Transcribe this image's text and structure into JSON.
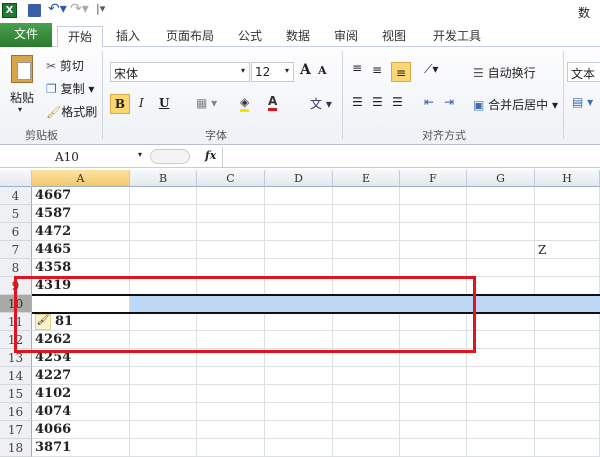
{
  "title_bar": {
    "title": "数据"
  },
  "tabs": [
    {
      "label": "文件"
    },
    {
      "label": "开始"
    },
    {
      "label": "插入"
    },
    {
      "label": "页面布局"
    },
    {
      "label": "公式"
    },
    {
      "label": "数据"
    },
    {
      "label": "审阅"
    },
    {
      "label": "视图"
    },
    {
      "label": "开发工具"
    }
  ],
  "ribbon": {
    "clipboard": {
      "paste": "粘贴",
      "cut": "剪切",
      "copy": "复制",
      "format_painter": "格式刷",
      "label": "剪贴板"
    },
    "font": {
      "font_name": "宋体",
      "font_size": "12",
      "bold": "B",
      "italic": "I",
      "underline": "U",
      "label": "字体"
    },
    "alignment": {
      "wrap": "自动换行",
      "merge": "合并后居中",
      "label": "对齐方式"
    },
    "number": {
      "format": "文本"
    }
  },
  "formula_bar": {
    "name_box": "A10",
    "fx": "fx",
    "value": ""
  },
  "columns": [
    "A",
    "B",
    "C",
    "D",
    "E",
    "F",
    "G",
    "H"
  ],
  "rows": [
    {
      "n": "4",
      "a": "4667"
    },
    {
      "n": "5",
      "a": "4587"
    },
    {
      "n": "6",
      "a": "4472"
    },
    {
      "n": "7",
      "a": "4465",
      "h": "Z"
    },
    {
      "n": "8",
      "a": "4358"
    },
    {
      "n": "9",
      "a": "4319"
    },
    {
      "n": "10",
      "a": ""
    },
    {
      "n": "11",
      "a": "81"
    },
    {
      "n": "12",
      "a": "4262"
    },
    {
      "n": "13",
      "a": "4254"
    },
    {
      "n": "14",
      "a": "4227"
    },
    {
      "n": "15",
      "a": "4102"
    },
    {
      "n": "16",
      "a": "4074"
    },
    {
      "n": "17",
      "a": "4066"
    },
    {
      "n": "18",
      "a": "3871"
    }
  ],
  "colors": {
    "file_tab": "#2f7d32",
    "highlight_box": "#e0141c",
    "selection": "#bcd8f5"
  }
}
